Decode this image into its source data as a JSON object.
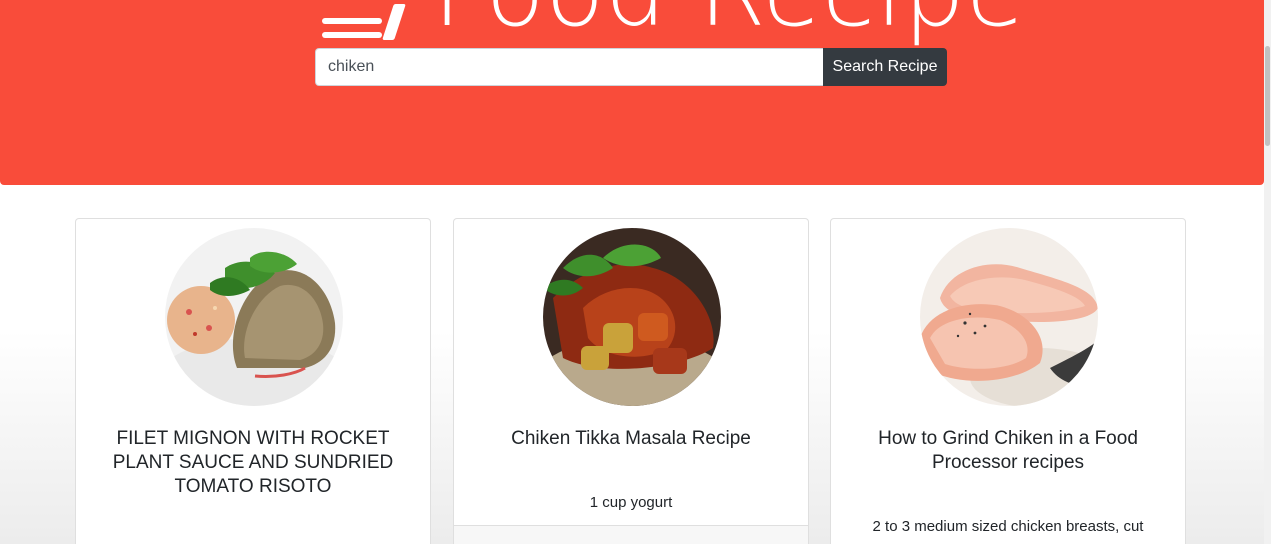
{
  "header": {
    "brand_title": "Food Recipe",
    "background_color": "#f94c3a"
  },
  "search": {
    "value": "chiken",
    "placeholder": "",
    "button_label": "Search Recipe"
  },
  "recipes": [
    {
      "title": "FILET MIGNON WITH ROCKET PLANT SAUCE AND SUNDRIED TOMATO RISOTO",
      "text": ""
    },
    {
      "title": "Chiken Tikka Masala Recipe",
      "text": "1 cup yogurt"
    },
    {
      "title": "How to Grind Chiken in a Food Processor recipes",
      "text": "2 to 3 medium sized chicken breasts, cut"
    }
  ]
}
